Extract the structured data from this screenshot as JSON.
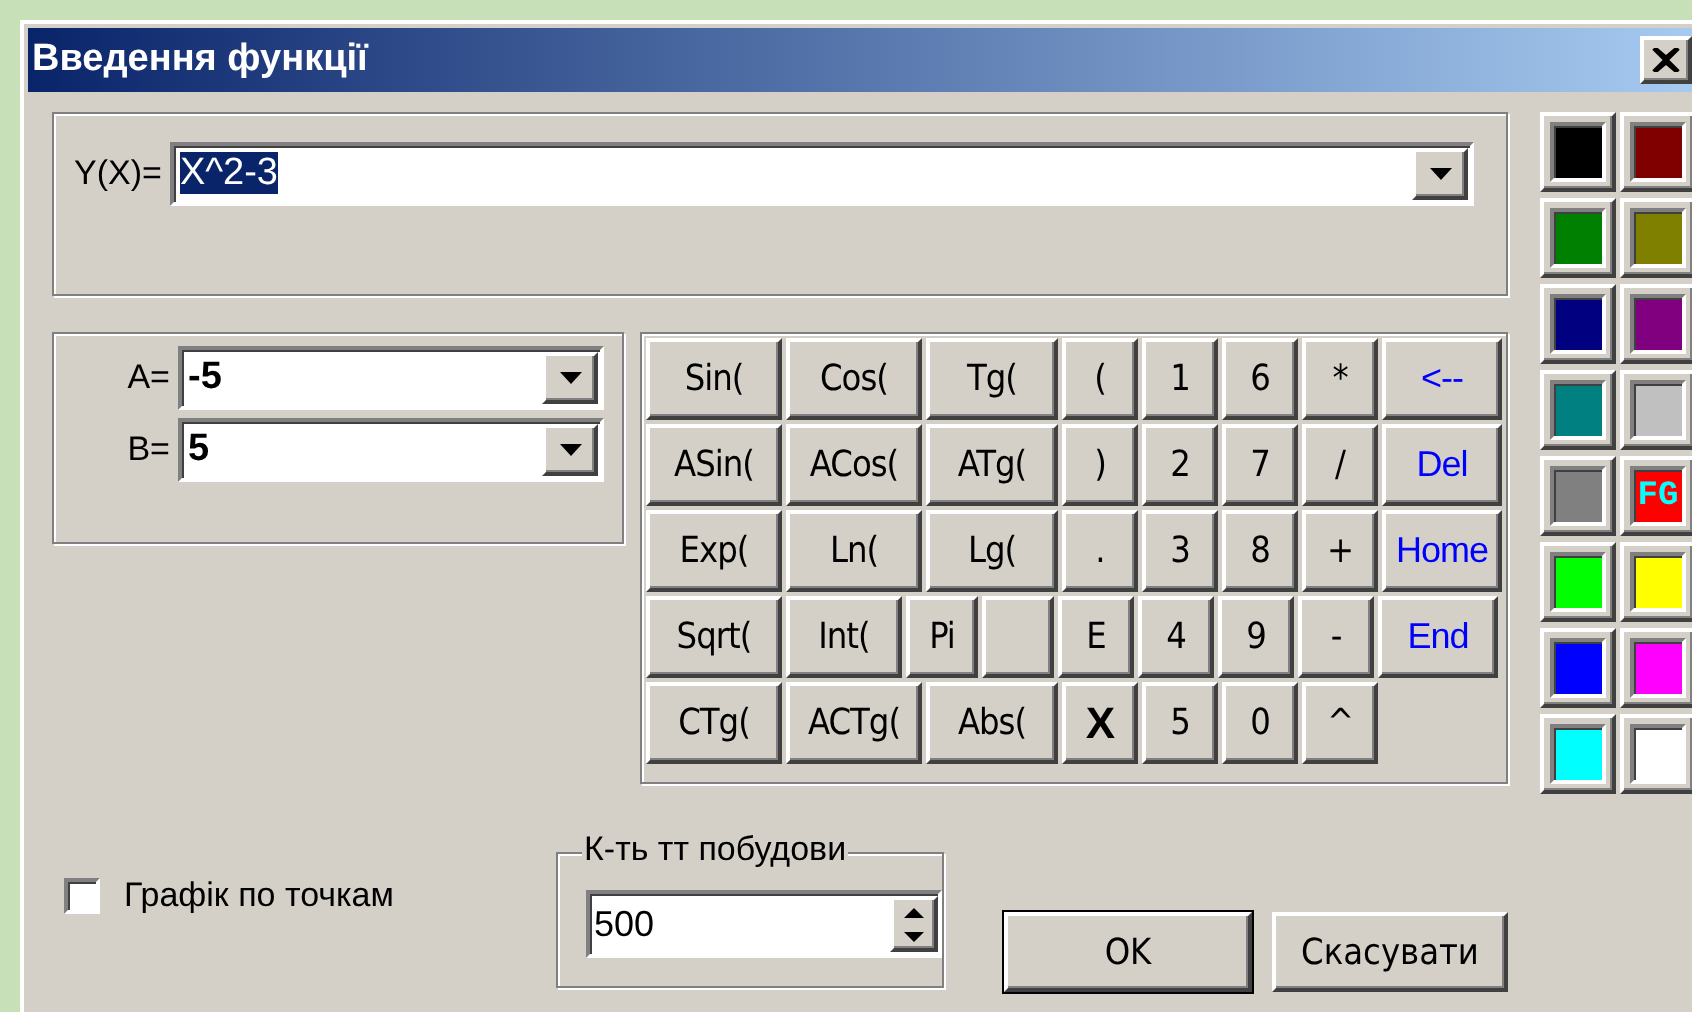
{
  "window": {
    "title": "Введення функції"
  },
  "function": {
    "label": "Y(X)=",
    "value": "X^2-3",
    "highlighted": true
  },
  "range": [
    {
      "label": "A=",
      "value": "-5"
    },
    {
      "label": "B=",
      "value": "5"
    }
  ],
  "keys": [
    [
      {
        "label": "Sin(",
        "kind": "func"
      },
      {
        "label": "Cos(",
        "kind": "func"
      },
      {
        "label": "Tg(",
        "kind": "func"
      },
      {
        "label": "(",
        "kind": "func"
      },
      {
        "label": "1",
        "kind": "func"
      },
      {
        "label": "6",
        "kind": "func"
      },
      {
        "label": "*",
        "kind": "func"
      },
      {
        "label": "<--",
        "kind": "nav"
      }
    ],
    [
      {
        "label": "ASin(",
        "kind": "func"
      },
      {
        "label": "ACos(",
        "kind": "func"
      },
      {
        "label": "ATg(",
        "kind": "func"
      },
      {
        "label": ")",
        "kind": "func"
      },
      {
        "label": "2",
        "kind": "func"
      },
      {
        "label": "7",
        "kind": "func"
      },
      {
        "label": "/",
        "kind": "func"
      },
      {
        "label": "Del",
        "kind": "nav"
      }
    ],
    [
      {
        "label": "Exp(",
        "kind": "func"
      },
      {
        "label": "Ln(",
        "kind": "func"
      },
      {
        "label": "Lg(",
        "kind": "func"
      },
      {
        "label": ".",
        "kind": "func"
      },
      {
        "label": "3",
        "kind": "func"
      },
      {
        "label": "8",
        "kind": "func"
      },
      {
        "label": "+",
        "kind": "func"
      },
      {
        "label": "Home",
        "kind": "nav"
      }
    ],
    [
      {
        "label": "Sqrt(",
        "kind": "func"
      },
      {
        "label": "Int(",
        "kind": "func"
      },
      {
        "label": "Pi",
        "kind": "func"
      },
      {
        "kind": "blank"
      },
      {
        "label": "E",
        "kind": "func"
      },
      {
        "label": "4",
        "kind": "func"
      },
      {
        "label": "9",
        "kind": "func"
      },
      {
        "label": "-",
        "kind": "func"
      },
      {
        "label": "End",
        "kind": "nav"
      }
    ],
    [
      {
        "label": "CTg(",
        "kind": "func"
      },
      {
        "label": "ACTg(",
        "kind": "func"
      },
      {
        "label": "Abs(",
        "kind": "func"
      },
      {
        "label": "X",
        "kind": "bold"
      },
      {
        "label": "5",
        "kind": "func"
      },
      {
        "label": "0",
        "kind": "func"
      },
      {
        "label": "^",
        "kind": "func"
      }
    ]
  ],
  "palette": [
    {
      "color": "#000000"
    },
    {
      "color": "#800000"
    },
    {
      "color": "#008000"
    },
    {
      "color": "#808000"
    },
    {
      "color": "#000080"
    },
    {
      "color": "#800080"
    },
    {
      "color": "#008080"
    },
    {
      "color": "#c0c0c0"
    },
    {
      "color": "#808080"
    },
    {
      "color": "#ff0000",
      "label": "FG"
    },
    {
      "color": "#00ff00"
    },
    {
      "color": "#ffff00"
    },
    {
      "color": "#0000ff"
    },
    {
      "color": "#ff00ff"
    },
    {
      "color": "#00ffff"
    },
    {
      "color": "#ffffff"
    }
  ],
  "plot_by_points": {
    "label": "Графік по точкам",
    "checked": false
  },
  "points": {
    "title": "К-ть тт побудови",
    "value": "500"
  },
  "buttons": [
    {
      "label": "OK",
      "default": true
    },
    {
      "label": "Скасувати",
      "default": false
    }
  ]
}
